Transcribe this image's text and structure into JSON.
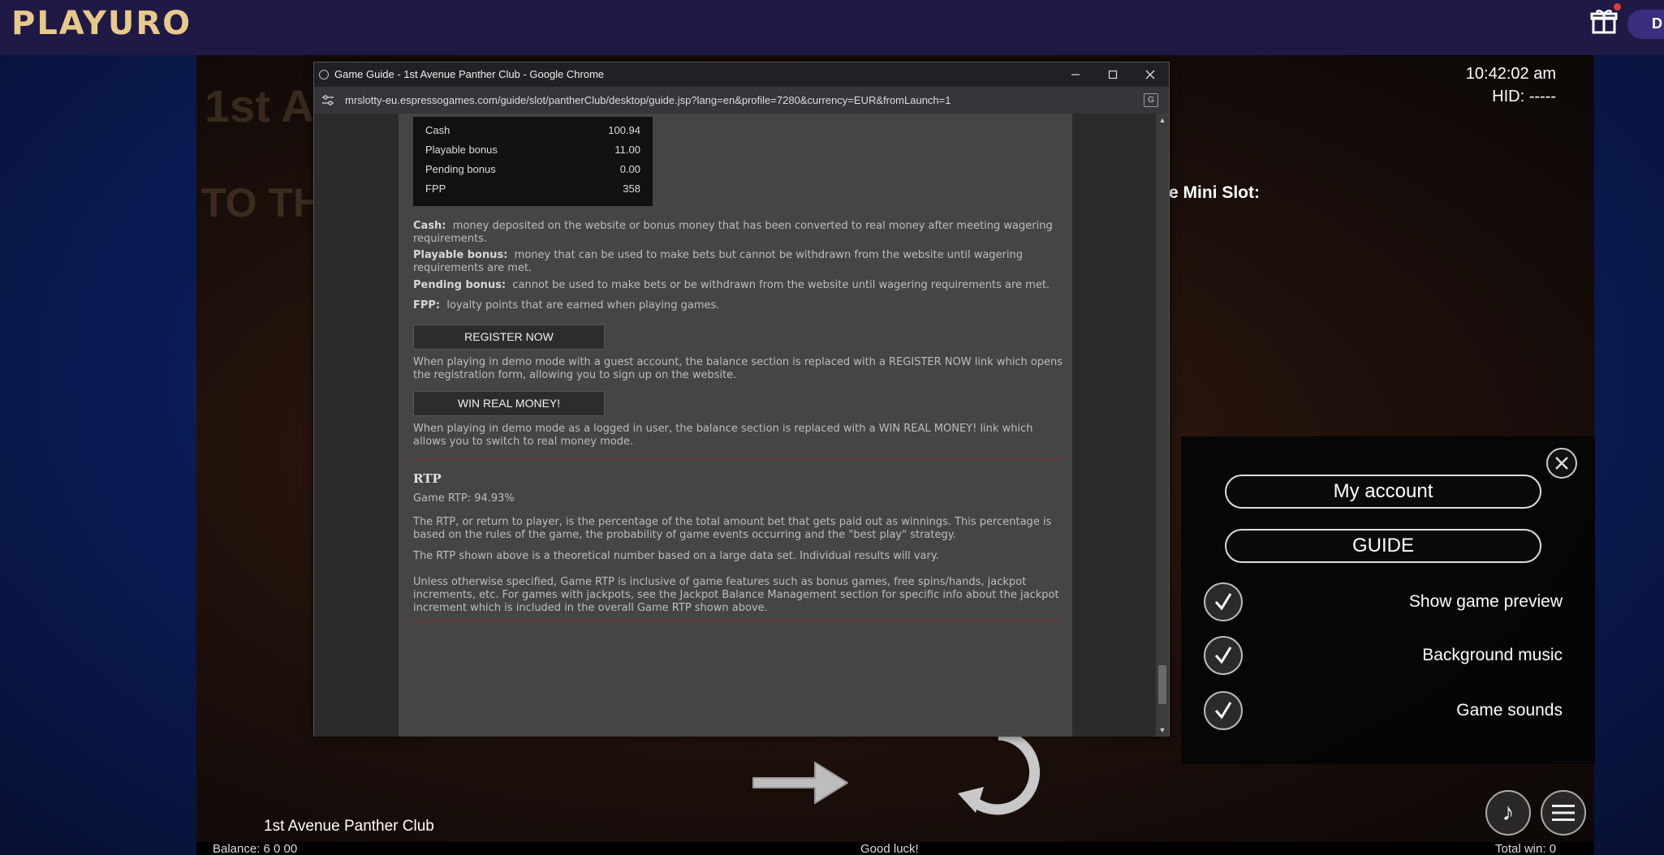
{
  "site": {
    "logo": "PLAYURO",
    "right_pill_text": "D"
  },
  "game": {
    "clock": "10:42:02 am",
    "hid": "HID: -----",
    "mini_slot_label": "e Mini Slot:",
    "bg_text_1": "1st A",
    "bg_text_2": "TO THE PANT",
    "title": "1st Avenue Panther Club",
    "bottom_left": "Balance: 6 0 00",
    "bottom_mid": "Good luck!",
    "bottom_right": "Total win: 0"
  },
  "settings": {
    "my_account": "My account",
    "guide": "GUIDE",
    "options": [
      {
        "label": "Show game preview",
        "checked": true
      },
      {
        "label": "Background music",
        "checked": true
      },
      {
        "label": "Game sounds",
        "checked": true
      }
    ]
  },
  "popup": {
    "window_title": "Game Guide - 1st Avenue Panther Club - Google Chrome",
    "url": "mrslotty-eu.espressogames.com/guide/slot/pantherClub/desktop/guide.jsp?lang=en&profile=7280&currency=EUR&fromLaunch=1",
    "balance_rows": [
      {
        "label": "Cash",
        "value": "100.94"
      },
      {
        "label": "Playable bonus",
        "value": "11.00"
      },
      {
        "label": "Pending bonus",
        "value": "0.00"
      },
      {
        "label": "FPP",
        "value": "358"
      }
    ],
    "defs": {
      "cash_term": "Cash:",
      "cash_text": "money deposited on the website or bonus money that has been converted to real money after meeting wagering requirements.",
      "playable_term": "Playable bonus:",
      "playable_text": "money that can be used to make bets but cannot be withdrawn from the website until wagering requirements are met.",
      "pending_term": "Pending bonus:",
      "pending_text": "cannot be used to make bets or be withdrawn from the website until wagering requirements are met.",
      "fpp_term": "FPP:",
      "fpp_text": "loyalty points that are earned when playing games."
    },
    "register_button": "REGISTER NOW",
    "register_text": "When playing in demo mode with a guest account, the balance section is replaced with a REGISTER NOW link which opens the registration form, allowing you to sign up on the website.",
    "win_button": "WIN REAL MONEY!",
    "win_text": "When playing in demo mode as a logged in user, the balance section is replaced with a WIN REAL MONEY! link which allows you to switch to real money mode.",
    "rtp_heading": "RTP",
    "rtp_value": "Game RTP: 94.93%",
    "rtp_p1": "The RTP, or return to player, is the percentage of the total amount bet that gets paid out as winnings. This percentage is based on the rules of the game, the probability of game events occurring and the \"best play\" strategy.",
    "rtp_p2": "The RTP shown above is a theoretical number based on a large data set. Individual results will vary.",
    "rtp_p3": "Unless otherwise specified, Game RTP is inclusive of game features such as bonus games, free spins/hands, jackpot increments, etc. For games with jackpots, see the Jackpot Balance Management section for specific info about the jackpot increment which is included in the overall Game RTP shown above."
  },
  "colors": {
    "topbar": "#1f1a45",
    "logo": "#e8c98a",
    "divider_red": "#8a2a2a"
  }
}
